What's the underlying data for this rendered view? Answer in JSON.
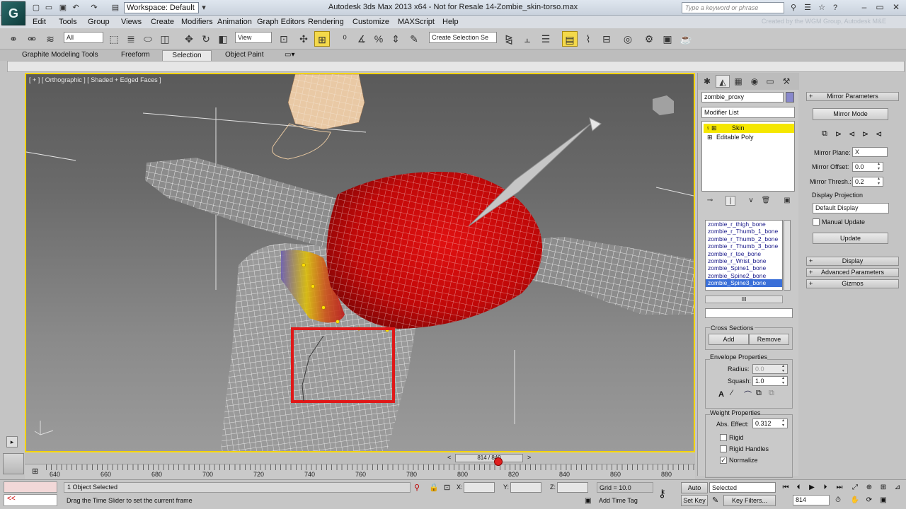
{
  "app": {
    "logo": "G",
    "workspace": "Workspace: Default",
    "title": "Autodesk 3ds Max  2013 x64   -  Not for Resale   14-Zombie_skin-torso.max",
    "search_placeholder": "Type a keyword or phrase",
    "credit": "Created by the WGM Group, Autodesk M&E"
  },
  "menu": [
    "Edit",
    "Tools",
    "Group",
    "Views",
    "Create",
    "Modifiers",
    "Animation",
    "Graph Editors",
    "Rendering",
    "Customize",
    "MAXScript",
    "Help"
  ],
  "toolbar": {
    "selection_filter": "All",
    "ref_coord": "View",
    "selection_set": "Create Selection Se"
  },
  "ribbon": {
    "tabs": [
      "Graphite Modeling Tools",
      "Freeform",
      "Selection",
      "Object Paint"
    ],
    "active_tab": "Selection"
  },
  "viewport": {
    "label": "[ + ] [ Orthographic ] [ Shaded + Edged Faces ]"
  },
  "command_panel": {
    "object_name": "zombie_proxy",
    "modifier_list": "Modifier List",
    "stack": [
      "Skin",
      "Editable Poly"
    ],
    "bones": [
      "zombie_r_thigh_bone",
      "zombie_r_Thumb_1_bone",
      "zombie_r_Thumb_2_bone",
      "zombie_r_Thumb_3_bone",
      "zombie_r_toe_bone",
      "zombie_r_Wrist_bone",
      "zombie_Spine1_bone",
      "zombie_Spine2_bone",
      "zombie_Spine3_bone"
    ],
    "selected_bone": "zombie_Spine3_bone",
    "hscroll_glyph": "III",
    "cross_sections": {
      "title": "Cross Sections",
      "add": "Add",
      "remove": "Remove"
    },
    "envelope": {
      "title": "Envelope Properties",
      "radius_label": "Radius:",
      "radius": "0.0",
      "squash_label": "Squash:",
      "squash": "1.0"
    },
    "weight": {
      "title": "Weight Properties",
      "abs_label": "Abs. Effect:",
      "abs": "0.312",
      "rigid": "Rigid",
      "rigid_handles": "Rigid Handles",
      "normalize": "Normalize"
    }
  },
  "mirror": {
    "title": "Mirror Parameters",
    "mode": "Mirror Mode",
    "plane_label": "Mirror Plane:",
    "plane": "X",
    "offset_label": "Mirror Offset:",
    "offset": "0.0",
    "thresh_label": "Mirror Thresh.:",
    "thresh": "0.2",
    "display_projection": "Display Projection",
    "display_value": "Default Display",
    "manual_update": "Manual Update",
    "update": "Update",
    "rollouts": [
      "Display",
      "Advanced Parameters",
      "Gizmos"
    ]
  },
  "timeline": {
    "slider": "814 / 840",
    "ticks": [
      "640",
      "660",
      "680",
      "700",
      "720",
      "740",
      "760",
      "780",
      "800",
      "820",
      "840",
      "860",
      "880"
    ]
  },
  "status": {
    "selection": "1 Object Selected",
    "prompt": "Drag the Time Slider to set the current frame",
    "x": "X:",
    "y": "Y:",
    "z": "Z:",
    "grid": "Grid = 10.0",
    "add_time_tag": "Add Time Tag",
    "auto_key": "Auto Key",
    "set_key": "Set Key",
    "key_mode": "Selected",
    "key_filters": "Key Filters...",
    "frame": "814",
    "maxscript_prompt": "<<"
  },
  "colors": {
    "viewport_border": "#f4d400",
    "selection_box": "#e01818",
    "skin_weight": "#d01010",
    "selected_modifier": "#f5e700"
  }
}
